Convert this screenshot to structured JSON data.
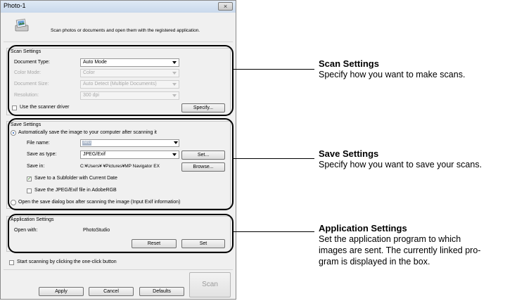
{
  "dialog": {
    "title": "Photo-1",
    "close_glyph": "×",
    "header_icon": "scanner-photo-icon",
    "header_text": "Scan photos or documents and open them with the registered application."
  },
  "scan_settings": {
    "group_label": "Scan Settings",
    "document_type_label": "Document Type:",
    "document_type_value": "Auto Mode",
    "color_mode_label": "Color Mode:",
    "color_mode_value": "Color",
    "document_size_label": "Document Size:",
    "document_size_value": "Auto Detect (Multiple Documents)",
    "resolution_label": "Resolution:",
    "resolution_value": "300 dpi",
    "use_driver_label": "Use the scanner driver",
    "use_driver_checked": false,
    "specify_button": "Specify..."
  },
  "save_settings": {
    "group_label": "Save Settings",
    "auto_save_label": "Automatically save the image to your computer after scanning it",
    "file_name_label": "File name:",
    "file_name_value": "IMG",
    "save_type_label": "Save as  type:",
    "save_type_value": "JPEG/Exif",
    "set_button": "Set...",
    "save_in_label": "Save in:",
    "save_in_value": "C:¥Users¥        ¥Pictures¥MP Navigator EX",
    "browse_button": "Browse...",
    "subfolder_label": "Save to a Subfolder with Current Date",
    "subfolder_checked": true,
    "adobergb_label": "Save the JPEG/Exif file in AdobeRGB",
    "adobergb_checked": false,
    "open_dialog_label": "Open the save dialog box after scanning the image (Input Exif information)"
  },
  "app_settings": {
    "group_label": "Application Settings",
    "open_with_label": "Open with:",
    "open_with_value": "PhotoStudio",
    "reset_button": "Reset",
    "set_button": "Set"
  },
  "footer": {
    "one_click_label": "Start scanning by clicking the one-click button",
    "apply_button": "Apply",
    "cancel_button": "Cancel",
    "defaults_button": "Defaults",
    "scan_button": "Scan"
  },
  "annotations": {
    "scan_title": "Scan Settings",
    "scan_text": "Specify how you want to make scans.",
    "save_title": "Save Settings",
    "save_text": "Specify how you want to save your scans.",
    "app_title": "Application Settings",
    "app_text_1": "Set the application program to which",
    "app_text_2": "images are sent. The currently linked pro-",
    "app_text_3": "gram is displayed in the box."
  }
}
